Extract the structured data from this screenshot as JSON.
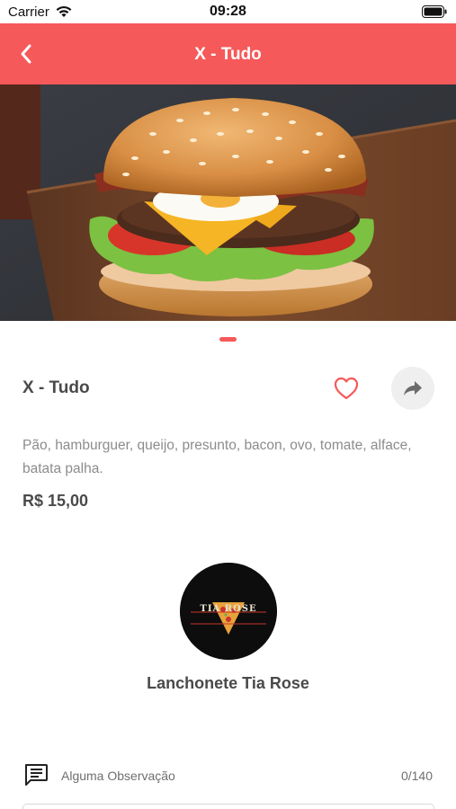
{
  "status_bar": {
    "carrier": "Carrier",
    "time": "09:28"
  },
  "nav": {
    "title": "X - Tudo"
  },
  "product": {
    "name": "X - Tudo",
    "description": "Pão, hamburguer, queijo, presunto, bacon, ovo, tomate, alface, batata palha.",
    "price": "R$ 15,00",
    "image_pages": 1,
    "current_page": 1
  },
  "store": {
    "name": "Lanchonete Tia Rose",
    "logo_text": "TIA ROSE",
    "logo_tagline": "PIZZARIA E FAST FOOD"
  },
  "observation": {
    "label": "Alguma Observação",
    "counter": "0/140"
  },
  "colors": {
    "accent": "#f65959",
    "text_dark": "#4a4a4a",
    "text_muted": "#8c8c8c",
    "share_bg": "#efefef"
  },
  "icons": {
    "back": "chevron-left-icon",
    "favorite": "heart-outline-icon",
    "share": "share-arrow-icon",
    "observation": "message-icon"
  }
}
